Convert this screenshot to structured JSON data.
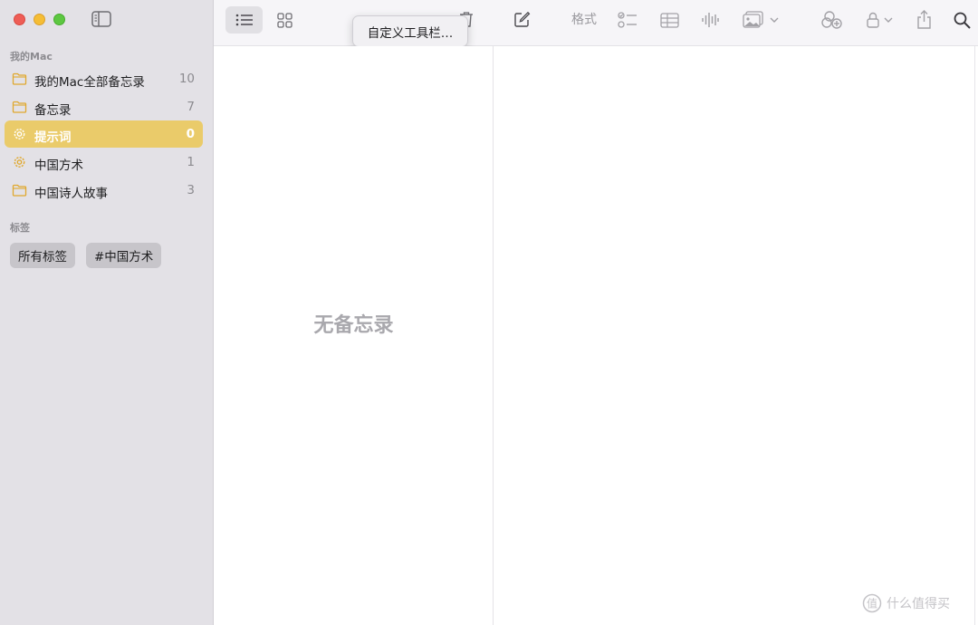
{
  "sidebar": {
    "section_mac": "我的Mac",
    "folders": [
      {
        "label": "我的Mac全部备忘录",
        "count": "10",
        "icon": "folder-icon"
      },
      {
        "label": "备忘录",
        "count": "7",
        "icon": "folder-icon"
      },
      {
        "label": "提示词",
        "count": "0",
        "icon": "gear-icon"
      },
      {
        "label": "中国方术",
        "count": "1",
        "icon": "gear-icon"
      },
      {
        "label": "中国诗人故事",
        "count": "3",
        "icon": "folder-icon"
      }
    ],
    "section_tags": "标签",
    "tags": [
      "所有标签",
      "#中国方术"
    ]
  },
  "toolbar": {
    "format_label": "格式",
    "context_menu_item": "自定义工具栏…"
  },
  "note_list": {
    "empty_message": "无备忘录"
  },
  "watermark": {
    "text": "什么值得买"
  },
  "colors": {
    "accent": "#eacb6a",
    "folder_icon": "#e0a82e",
    "sidebar_bg": "#e3e1e6"
  }
}
